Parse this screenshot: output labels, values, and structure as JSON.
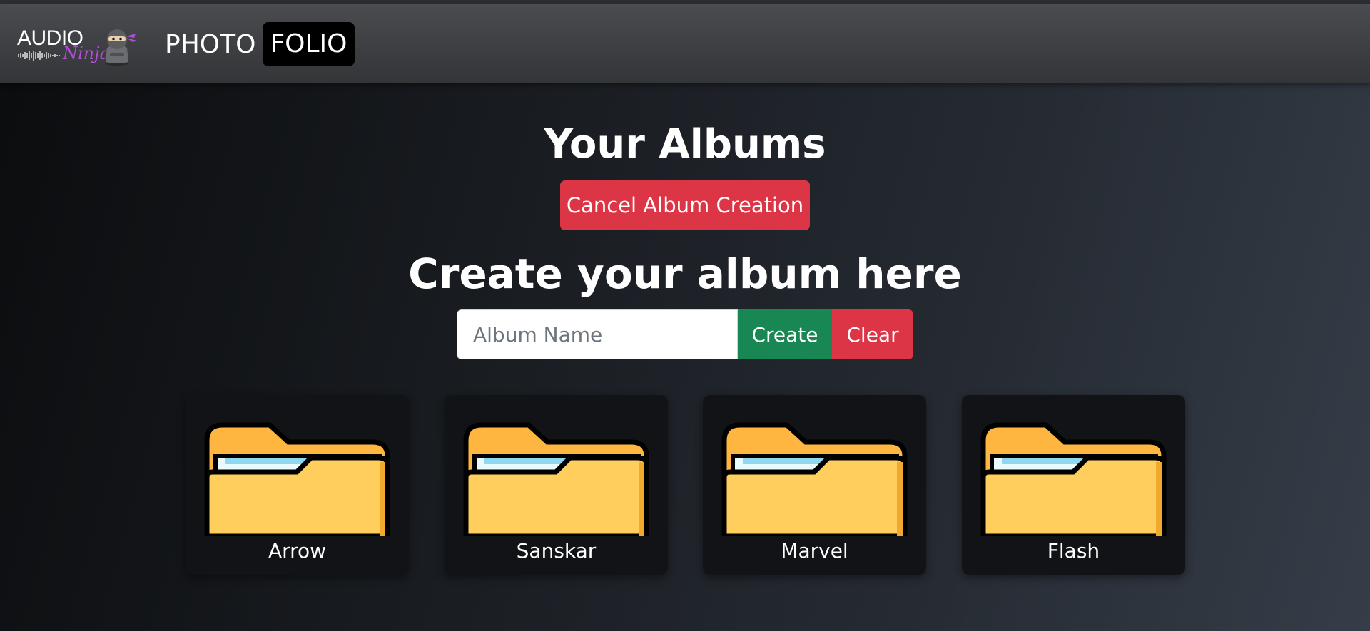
{
  "navbar": {
    "logo": {
      "text_top": "AUDIO",
      "text_bottom": "Ninja",
      "icon": "ninja-logo-icon"
    },
    "brand": {
      "word1": "PHOTO",
      "word2": "FOLIO"
    }
  },
  "page": {
    "title": "Your Albums",
    "cancel_button_label": "Cancel Album Creation",
    "subtitle": "Create your album here"
  },
  "form": {
    "album_name_value": "",
    "album_name_placeholder": "Album Name",
    "create_label": "Create",
    "clear_label": "Clear"
  },
  "albums": [
    {
      "name": "Arrow",
      "icon": "folder-icon"
    },
    {
      "name": "Sanskar",
      "icon": "folder-icon"
    },
    {
      "name": "Marvel",
      "icon": "folder-icon"
    },
    {
      "name": "Flash",
      "icon": "folder-icon"
    }
  ],
  "colors": {
    "danger": "#dc3545",
    "success": "#198754",
    "navbar": "#3d3f42",
    "card": "#121316",
    "folder": "#ffce5c"
  }
}
